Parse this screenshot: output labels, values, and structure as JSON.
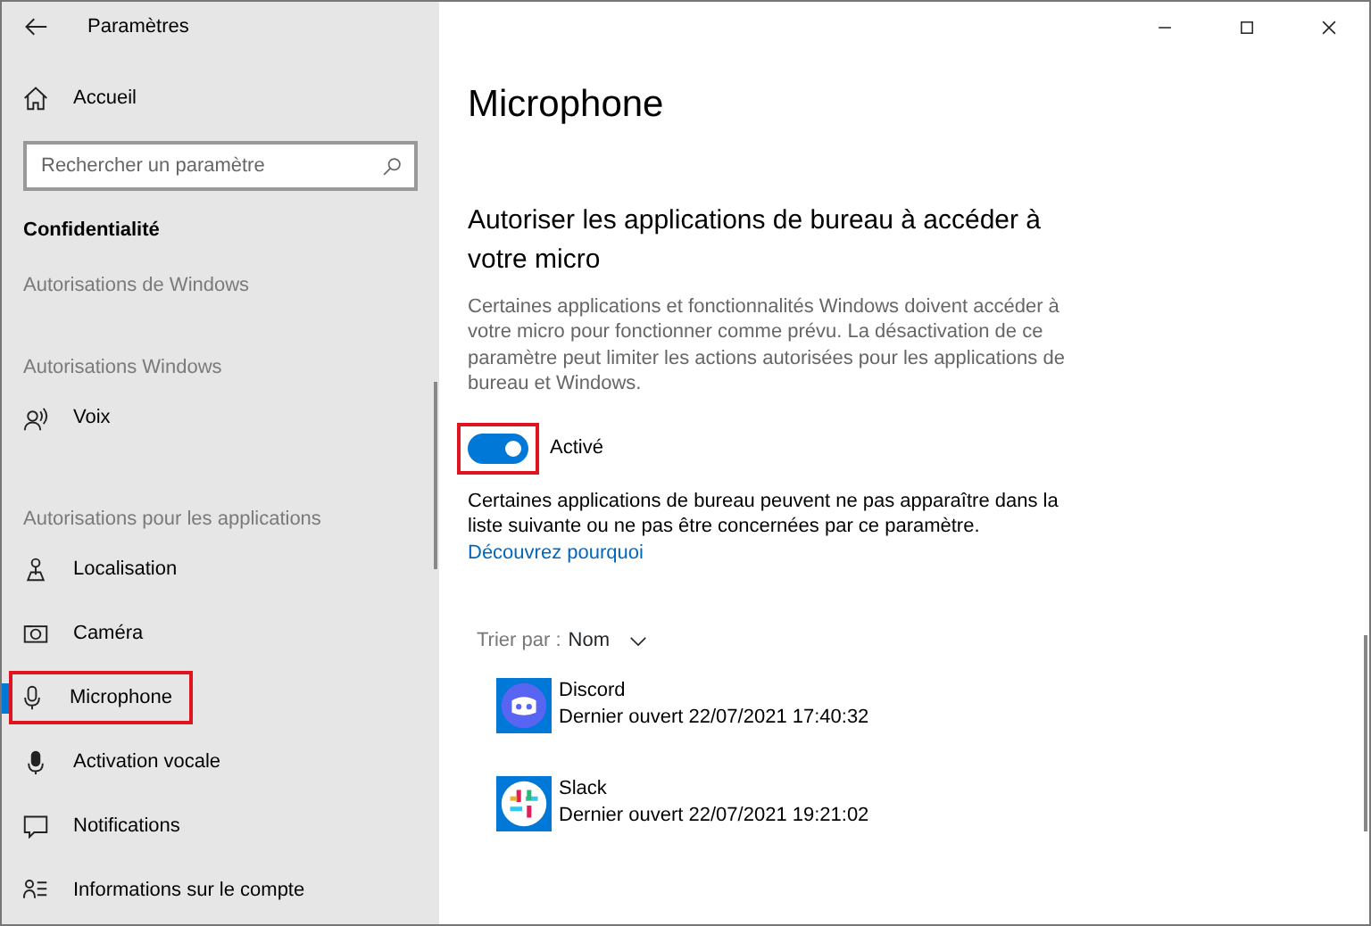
{
  "window": {
    "title": "Paramètres"
  },
  "sidebar": {
    "home": "Accueil",
    "search": {
      "placeholder": "Rechercher un paramètre"
    },
    "category": "Confidentialité",
    "entries": [
      {
        "kind": "section",
        "label": "Autorisations de Windows"
      },
      {
        "kind": "section",
        "label": "Autorisations Windows"
      },
      {
        "kind": "item",
        "label": "Voix",
        "selected": false,
        "highlighted": false
      },
      {
        "kind": "section",
        "label": "Autorisations pour les applications"
      },
      {
        "kind": "item",
        "label": "Localisation",
        "selected": false,
        "highlighted": false
      },
      {
        "kind": "item",
        "label": "Caméra",
        "selected": false,
        "highlighted": false
      },
      {
        "kind": "item",
        "label": "Microphone",
        "selected": true,
        "highlighted": true
      },
      {
        "kind": "item",
        "label": "Activation vocale",
        "selected": false,
        "highlighted": false
      },
      {
        "kind": "item",
        "label": "Notifications",
        "selected": false,
        "highlighted": false
      },
      {
        "kind": "item",
        "label": "Informations sur le compte",
        "selected": false,
        "highlighted": false
      }
    ]
  },
  "main": {
    "title": "Microphone",
    "heading": "Autoriser les applications de bureau à accéder à votre micro",
    "description": "Certaines applications et fonctionnalités Windows doivent accéder à votre micro pour fonctionner comme prévu. La désactivation de ce paramètre peut limiter les actions autorisées pour les applications de bureau et Windows.",
    "toggle": {
      "on": true,
      "label": "Activé",
      "highlighted": true
    },
    "note": "Certaines applications de bureau peuvent ne pas apparaître dans la liste suivante ou ne pas être concernées par ce paramètre.",
    "note_link": "Découvrez pourquoi",
    "sort": {
      "label": "Trier par :",
      "value": "Nom"
    },
    "apps": [
      {
        "name": "Discord",
        "last_opened": "Dernier ouvert 22/07/2021 17:40:32"
      },
      {
        "name": "Slack",
        "last_opened": "Dernier ouvert 22/07/2021 19:21:02"
      }
    ]
  }
}
